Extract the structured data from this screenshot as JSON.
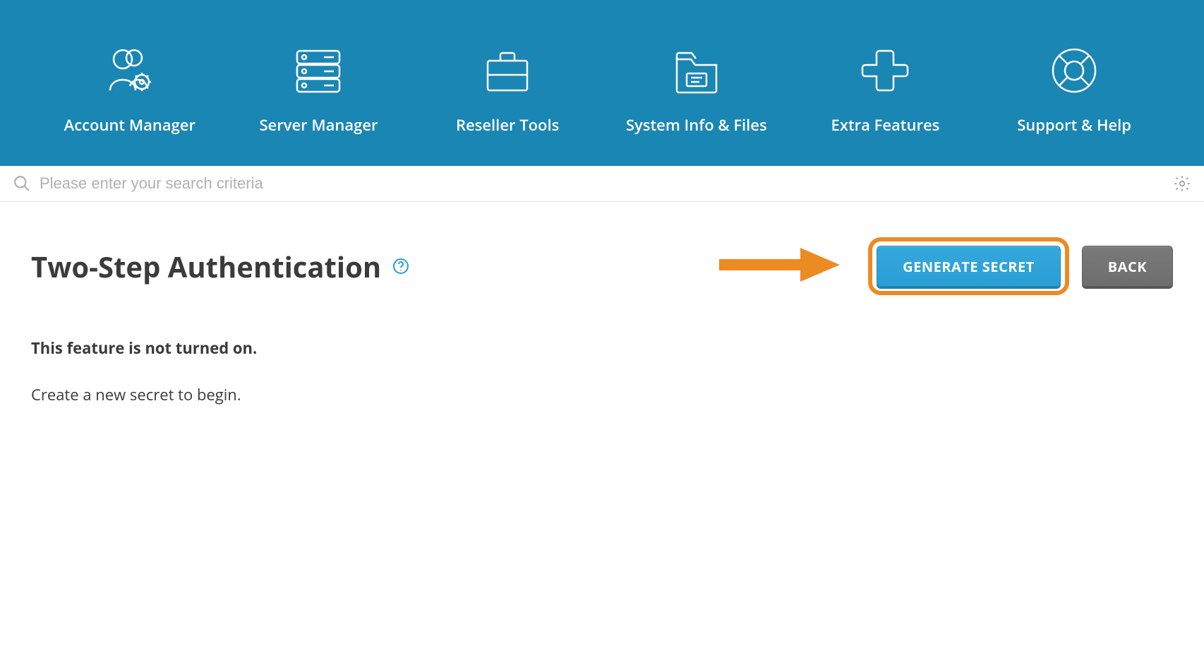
{
  "nav": {
    "items": [
      {
        "label": "Account Manager"
      },
      {
        "label": "Server Manager"
      },
      {
        "label": "Reseller Tools"
      },
      {
        "label": "System Info & Files"
      },
      {
        "label": "Extra Features"
      },
      {
        "label": "Support & Help"
      }
    ]
  },
  "search": {
    "placeholder": "Please enter your search criteria"
  },
  "page": {
    "title": "Two-Step Authentication",
    "generate_label": "GENERATE SECRET",
    "back_label": "BACK",
    "status_text": "This feature is not turned on.",
    "help_text": "Create a new secret to begin."
  }
}
